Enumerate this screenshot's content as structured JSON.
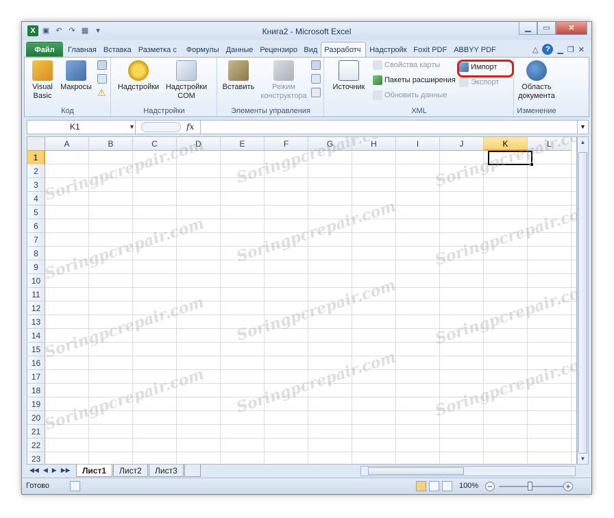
{
  "title": "Книга2 - Microsoft Excel",
  "tabs": [
    "Файл",
    "Главная",
    "Вставка",
    "Разметка с",
    "Формулы",
    "Данные",
    "Рецензиро",
    "Вид",
    "Разработч",
    "Надстройк",
    "Foxit PDF",
    "ABBYY PDF"
  ],
  "ribbon": {
    "code": {
      "label": "Код",
      "visual_basic": "Visual Basic",
      "macros": "Макросы"
    },
    "addins": {
      "label": "Надстройки",
      "addins": "Надстройки",
      "com": "Надстройки COM"
    },
    "controls": {
      "label": "Элементы управления",
      "insert": "Вставить",
      "design_mode": "Режим конструктора"
    },
    "xml": {
      "label": "XML",
      "source": "Источник",
      "map_properties": "Свойства карты",
      "expansion_packs": "Пакеты расширения",
      "refresh_data": "Обновить данные",
      "import": "Импорт",
      "export": "Экспорт"
    },
    "modify": {
      "label": "Изменение",
      "document_panel": "Область документа"
    }
  },
  "formula_bar": {
    "name_box": "K1",
    "fx": "fx",
    "value": ""
  },
  "columns": [
    "A",
    "B",
    "C",
    "D",
    "E",
    "F",
    "G",
    "H",
    "I",
    "J",
    "K",
    "L"
  ],
  "rows": [
    "1",
    "2",
    "3",
    "4",
    "5",
    "6",
    "7",
    "8",
    "9",
    "10",
    "11",
    "12",
    "13",
    "14",
    "15",
    "16",
    "17",
    "18",
    "19",
    "20",
    "21",
    "22",
    "23"
  ],
  "selected_cell": {
    "column": "K",
    "row": "1"
  },
  "sheets": [
    "Лист1",
    "Лист2",
    "Лист3"
  ],
  "active_sheet": "Лист1",
  "status": {
    "ready": "Готово",
    "zoom": "100%"
  },
  "watermark": "Soringpcrepair.com",
  "colors": {
    "accent": "#1e7b3c",
    "highlight": "#e81818",
    "selection": "#f9d270"
  }
}
